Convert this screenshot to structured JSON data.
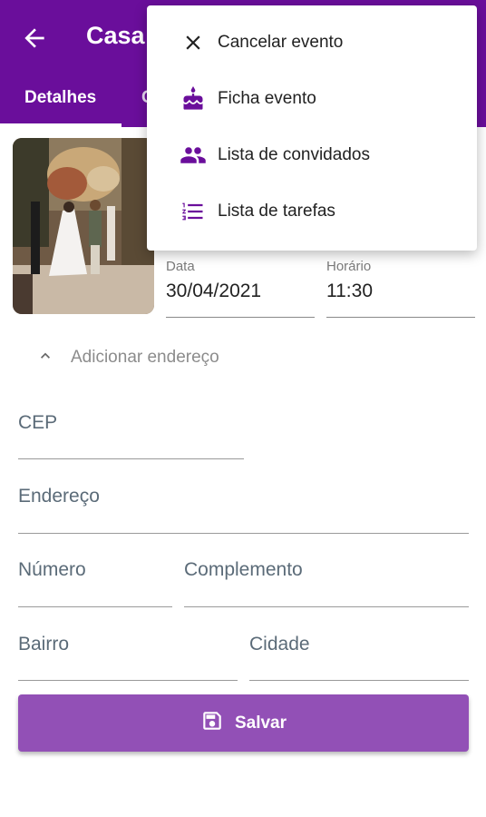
{
  "appbar": {
    "title": "Casa",
    "back_label": "Voltar"
  },
  "tabs": [
    {
      "label": "Detalhes"
    },
    {
      "label": "C"
    }
  ],
  "event": {
    "date_label": "Data",
    "date_value": "30/04/2021",
    "time_label": "Horário",
    "time_value": "11:30"
  },
  "address": {
    "toggle_label": "Adicionar endereço",
    "fields": {
      "cep": "CEP",
      "endereco": "Endereço",
      "numero": "Número",
      "complemento": "Complemento",
      "bairro": "Bairro",
      "cidade": "Cidade"
    }
  },
  "save_button": {
    "label": "Salvar"
  },
  "menu": {
    "items": [
      {
        "label": "Cancelar evento",
        "icon": "close-icon"
      },
      {
        "label": "Ficha evento",
        "icon": "cake-icon"
      },
      {
        "label": "Lista de convidados",
        "icon": "people-icon"
      },
      {
        "label": "Lista de tarefas",
        "icon": "checklist-icon"
      }
    ]
  },
  "colors": {
    "primary": "#6a0e9b",
    "button": "#9250b6",
    "menu_icon": "#6a0e9b"
  }
}
